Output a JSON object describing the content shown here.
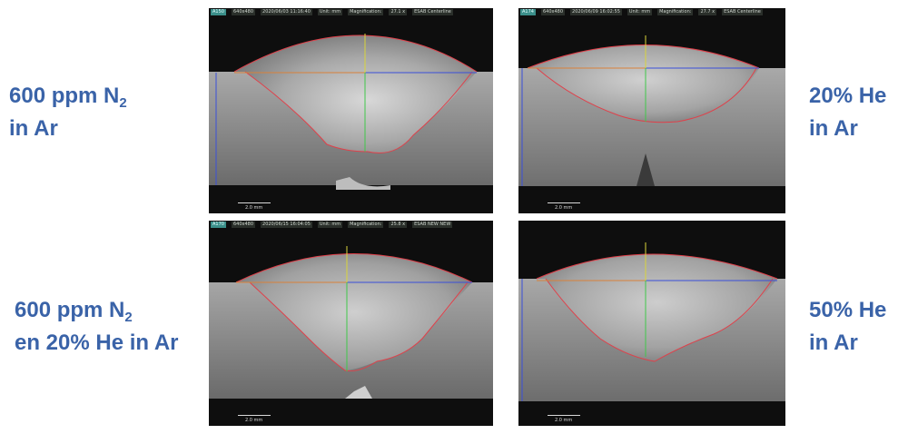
{
  "labels": {
    "top_left": {
      "line1_main": "600 ppm N",
      "line1_sub": "2",
      "line2": "in Ar"
    },
    "top_right": {
      "line1": "20% He",
      "line2": "in Ar"
    },
    "bottom_left": {
      "line1_main": "600 ppm N",
      "line1_sub": "2",
      "line2": "en 20% He in Ar"
    },
    "bottom_right": {
      "line1": "50% He",
      "line2": "in Ar"
    }
  },
  "label_color": "#3a63a8",
  "panels": [
    {
      "id": "A150",
      "res": "640x480",
      "datetime": "2020/06/03 11:16:40",
      "unit": "Unit: mm",
      "magnification": "Magnification:",
      "mag_value": "27.1 x",
      "tag": "ESAB Centerline",
      "scale": "2.0 mm"
    },
    {
      "id": "A174",
      "res": "640x480",
      "datetime": "2020/06/09 16:02:55",
      "unit": "Unit: mm",
      "magnification": "Magnification:",
      "mag_value": "27.7 x",
      "tag": "ESAB Centerline",
      "scale": "2.0 mm"
    },
    {
      "id": "A170",
      "res": "640x480",
      "datetime": "2020/06/15 16:04:05",
      "unit": "Unit: mm",
      "magnification": "Magnification:",
      "mag_value": "25.8 x",
      "tag": "ESAB NEW NEW",
      "scale": "2.0 mm"
    },
    {
      "id": "",
      "res": "",
      "datetime": "",
      "unit": "",
      "magnification": "",
      "mag_value": "",
      "tag": "",
      "scale": "2.0 mm"
    }
  ],
  "colors": {
    "fusion_line": "#e0404a",
    "horizontal_left": "#d9813a",
    "horizontal_right": "#3a4fd9",
    "vertical_top": "#d9d43a",
    "vertical_bottom": "#40c84a",
    "metal": "#9a9a9a",
    "background": "#111111"
  }
}
